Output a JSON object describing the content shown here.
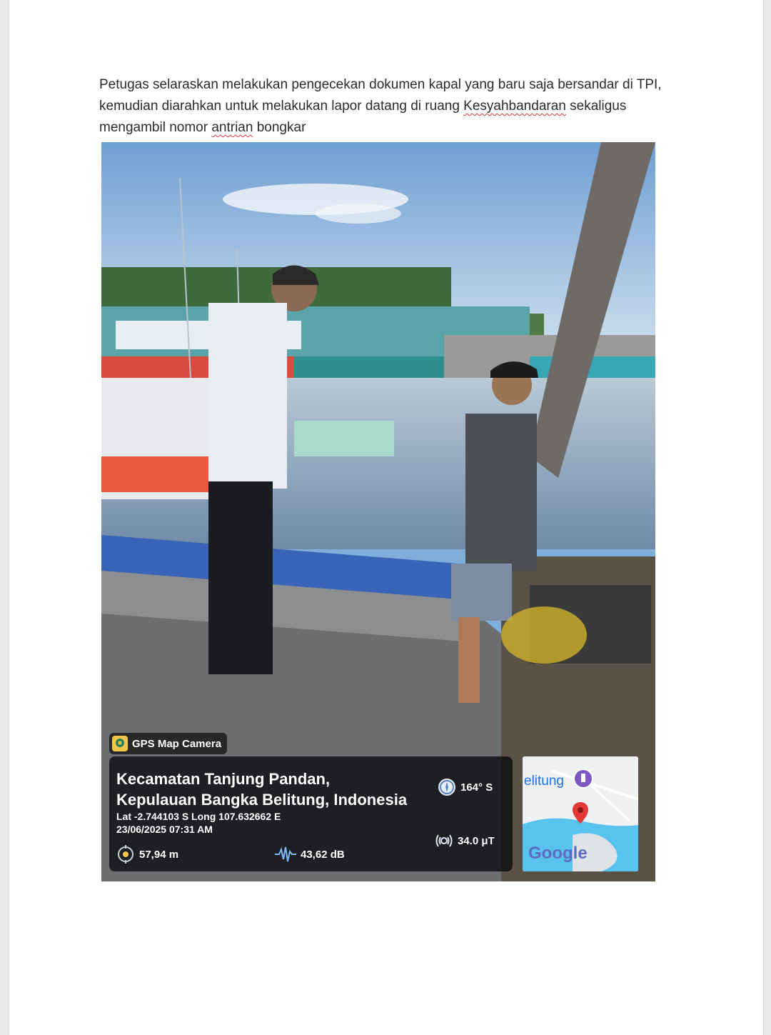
{
  "document": {
    "paragraph": {
      "part1": "Petugas selaraskan  melakukan pengecekan dokumen kapal yang baru saja bersandar di TPI, kemudian diarahkan untuk melakukan lapor datang di ruang ",
      "misspelled1": "Kesyahbandaran",
      "part2": " sekaligus mengambil nomor ",
      "misspelled2": "antrian",
      "part3": " bongkar"
    }
  },
  "photo": {
    "overlay": {
      "app_name": "GPS Map Camera",
      "location_line1": "Kecamatan Tanjung Pandan,",
      "location_line2": "Kepulauan Bangka Belitung, Indonesia",
      "coordinates": "Lat -2.744103 S Long 107.632662 E",
      "datetime": "23/06/2025 07:31 AM",
      "heading": "164° S",
      "magnetic_field": "34.0 μT",
      "altitude": "57,94 m",
      "sound_level": "43,62 dB",
      "map_label": "elitung",
      "map_brand": "Google"
    },
    "icons": {
      "compass": "compass-icon",
      "magnet": "magnetic-field-icon",
      "altitude": "altitude-icon",
      "sound": "sound-wave-icon",
      "map_pin": "map-pin-icon"
    },
    "colors": {
      "sky": "#7faedb",
      "water": "#8fa9c4",
      "blue_edge": "#3a64b8",
      "map_pin": "#e53935"
    }
  }
}
